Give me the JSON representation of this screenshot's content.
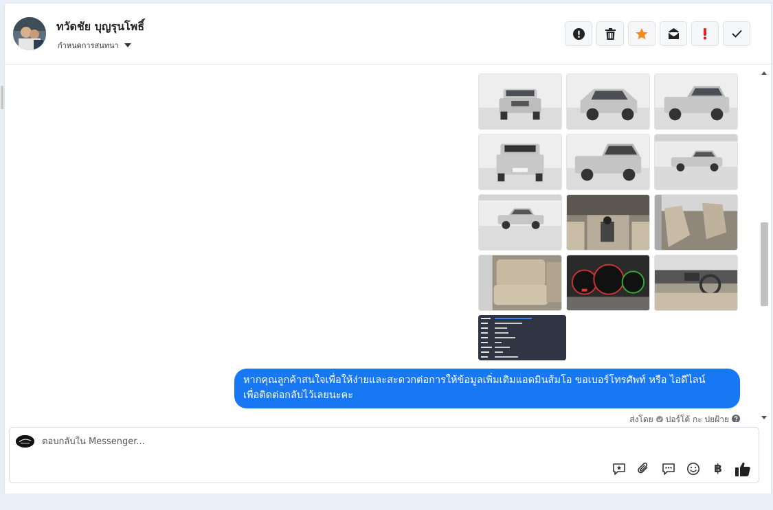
{
  "header": {
    "contact_name": "ทวัดชัย บุญรุนโพธิ์",
    "conversation_setting": "กำหนดการสนทนา",
    "tools": [
      {
        "name": "report-icon",
        "color": "#222222"
      },
      {
        "name": "trash-icon",
        "color": "#222222"
      },
      {
        "name": "star-icon",
        "color": "#f28c1e"
      },
      {
        "name": "mark-unread-icon",
        "color": "#222222"
      },
      {
        "name": "important-icon",
        "color": "#e02424"
      },
      {
        "name": "check-icon",
        "color": "#222222"
      }
    ]
  },
  "gallery": {
    "images": [
      "car-front-photo",
      "car-front-three-quarter-photo",
      "car-rear-three-quarter-photo",
      "car-rear-photo",
      "car-rear-side-photo",
      "car-side-photo",
      "car-side-studio-photo",
      "gear-console-photo",
      "front-seats-photo",
      "rear-seats-photo",
      "instrument-cluster-photo",
      "dashboard-photo"
    ],
    "document_image": "car-spec-sheet-image"
  },
  "message": {
    "line1": "หากคุณลูกค้าสนใจเพื่อให้ง่ายและสะดวกต่อการให้ข้อมูลเพิ่มเติมแอดมินส้มโอ ขอเบอร์โทรศัพท์ หรือ ไอดีไลน์",
    "line2": "เพื่อติดต่อกลับไว้เลยนะคะ",
    "bubble_color": "#1877f2"
  },
  "sent_by": {
    "prefix": "ส่งโดย",
    "name": "ปอร์โต้ กะ ปยฝ้าย"
  },
  "reply": {
    "placeholder": "ตอบกลับใน Messenger...",
    "currency_symbol": "฿",
    "tools": [
      "saved-reply-icon",
      "attachment-icon",
      "chat-icon",
      "emoji-icon",
      "currency-icon",
      "like-icon"
    ]
  }
}
